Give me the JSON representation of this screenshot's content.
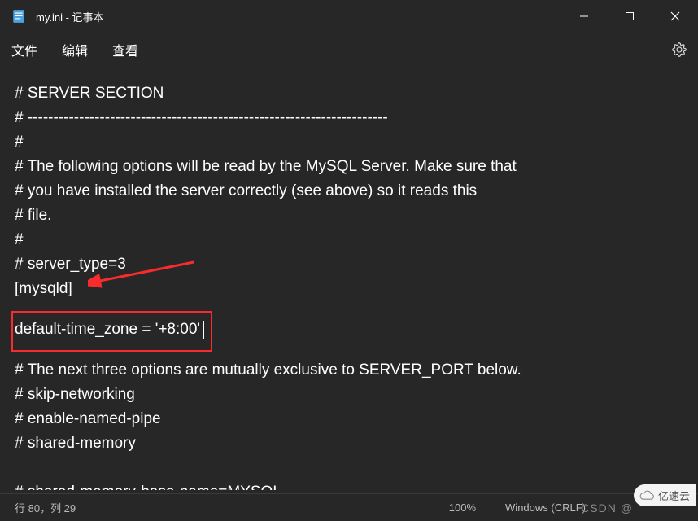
{
  "titlebar": {
    "title": "my.ini - 记事本"
  },
  "menu": {
    "file": "文件",
    "edit": "编辑",
    "view": "查看"
  },
  "content": {
    "l0": "# SERVER SECTION",
    "l1": "# ----------------------------------------------------------------------",
    "l2": "#",
    "l3": "# The following options will be read by the MySQL Server. Make sure that",
    "l4": "# you have installed the server correctly (see above) so it reads this",
    "l5": "# file.",
    "l6": "#",
    "l7": "# server_type=3",
    "l8": "[mysqld]",
    "highlight": "default-time_zone = '+8:00'",
    "l9": "# The next three options are mutually exclusive to SERVER_PORT below.",
    "l10": "# skip-networking",
    "l11": "# enable-named-pipe",
    "l12": "# shared-memory",
    "l13": "# shared-memory-base-name=MYSQL"
  },
  "status": {
    "position": "行 80，列 29",
    "zoom": "100%",
    "lineending": "Windows (CRLF)"
  },
  "watermark": {
    "csdn": "CSDN @",
    "text": "亿速云"
  }
}
